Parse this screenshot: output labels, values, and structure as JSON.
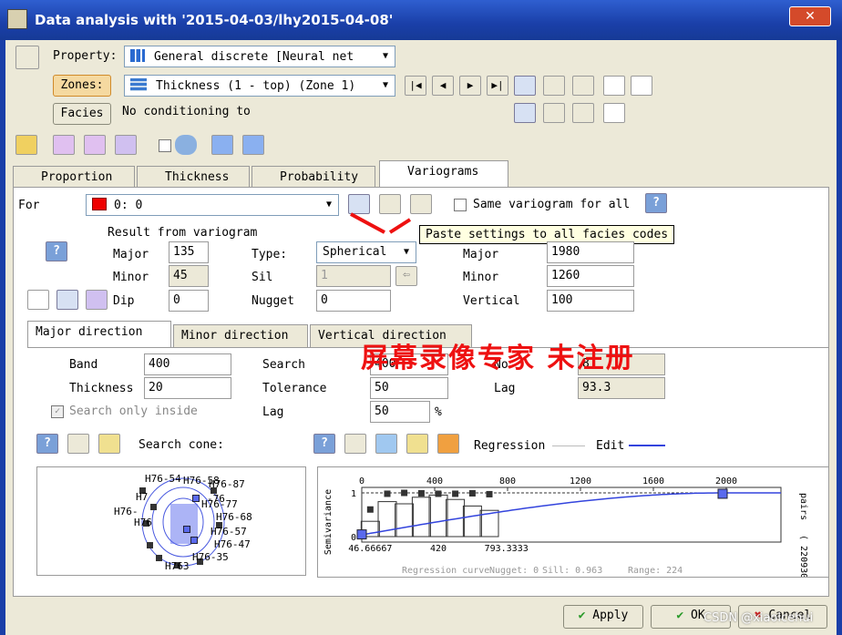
{
  "window": {
    "title": "Data analysis with '2015-04-03/lhy2015-04-08'",
    "close": "✕"
  },
  "top": {
    "property_label": "Property:",
    "property_value": "General discrete [Neural net",
    "zones_label": "Zones:",
    "zones_value": "Thickness (1 - top) (Zone 1)",
    "facies_label": "Facies",
    "facies_value": "No conditioning to"
  },
  "tabs": [
    "Proportion",
    "Thickness",
    "Probability",
    "Variograms"
  ],
  "for_row": {
    "label": "For",
    "value": "0: 0",
    "same_label": "Same variogram for all"
  },
  "tooltip": "Paste settings to all facies codes",
  "result": {
    "header": "Result from variogram",
    "major_label": "Major",
    "major": "135",
    "minor_label": "Minor",
    "minor": "45",
    "dip_label": "Dip",
    "dip": "0",
    "type_label": "Type:",
    "type_value": "Spherical",
    "sill_label": "Sil",
    "sill": "1",
    "nugget_label": "Nugget",
    "nugget": "0",
    "r_major_label": "Major",
    "r_major": "1980",
    "r_minor_label": "Minor",
    "r_minor": "1260",
    "r_vertical_label": "Vertical",
    "r_vertical": "100"
  },
  "dir_tabs": [
    "Major direction",
    "Minor direction",
    "Vertical direction"
  ],
  "search": {
    "band_label": "Band",
    "band": "400",
    "thickness_label": "Thickness",
    "thickness": "20",
    "only_inside": "Search only inside",
    "search_label": "Search",
    "search": "400",
    "tolerance_label": "Tolerance",
    "tolerance": "50",
    "lag_label": "Lag",
    "lag": "50",
    "pct": "%",
    "no_label": "No",
    "no": "8",
    "lag2_label": "Lag",
    "lag2": "93.3"
  },
  "cone_label": "Search cone:",
  "regression_label": "Regression",
  "edit_label": "Edit",
  "watermark": "屏幕录像专家  未注册",
  "cone_labels": [
    "H76-54",
    "H76-58",
    "H76-87",
    "H7",
    "H76-",
    "H76",
    "-76",
    "H76-77",
    "H76-68",
    "H76-57",
    "H76-47",
    "H76-35",
    "H763"
  ],
  "chart_data": {
    "type": "scatter",
    "x_ticks_top": [
      "0",
      "400",
      "800",
      "1200",
      "1600",
      "2000"
    ],
    "x_ticks_bottom": [
      "46.66667",
      "420",
      "793.3333"
    ],
    "y_ticks": [
      "1",
      "0"
    ],
    "ylabel": "Semivariance",
    "right_label": "pairs",
    "right_value": "( 220930",
    "footer": [
      "Regression curve",
      "Nugget: 0",
      "Sill: 0.963",
      "Range: 224"
    ],
    "series": [
      {
        "x": [
          46.7,
          140,
          233,
          327,
          420,
          513,
          607,
          700
        ],
        "y": [
          0.62,
          0.98,
          1.0,
          0.99,
          0.98,
          0.98,
          0.99,
          0.97
        ]
      }
    ]
  },
  "buttons": {
    "apply": "Apply",
    "ok": "OK",
    "cancel": "Cancel"
  },
  "credit": "CSDN @xiaolcehui"
}
